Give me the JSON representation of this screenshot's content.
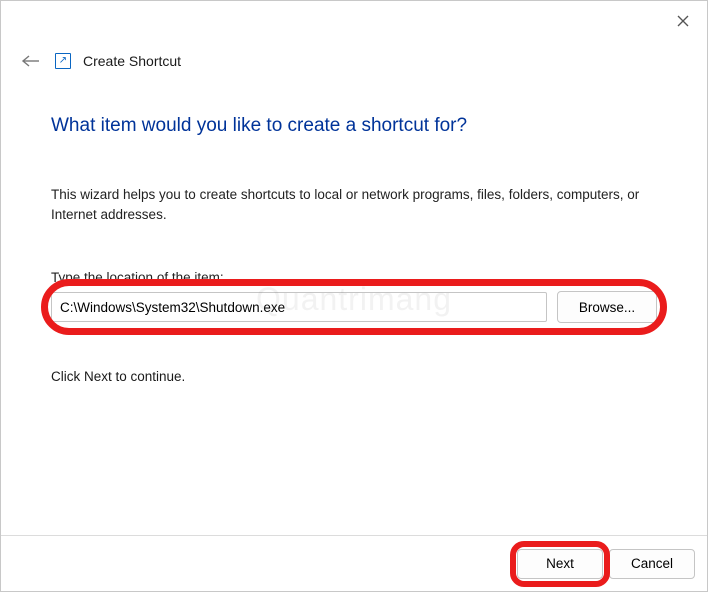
{
  "header": {
    "title": "Create Shortcut"
  },
  "main": {
    "heading": "What item would you like to create a shortcut for?",
    "description": "This wizard helps you to create shortcuts to local or network programs, files, folders, computers, or Internet addresses.",
    "field_label": "Type the location of the item:",
    "location_value": "C:\\Windows\\System32\\Shutdown.exe",
    "browse_label": "Browse...",
    "continue_text": "Click Next to continue."
  },
  "footer": {
    "next_label": "Next",
    "cancel_label": "Cancel"
  },
  "watermark": "Quantrimang"
}
